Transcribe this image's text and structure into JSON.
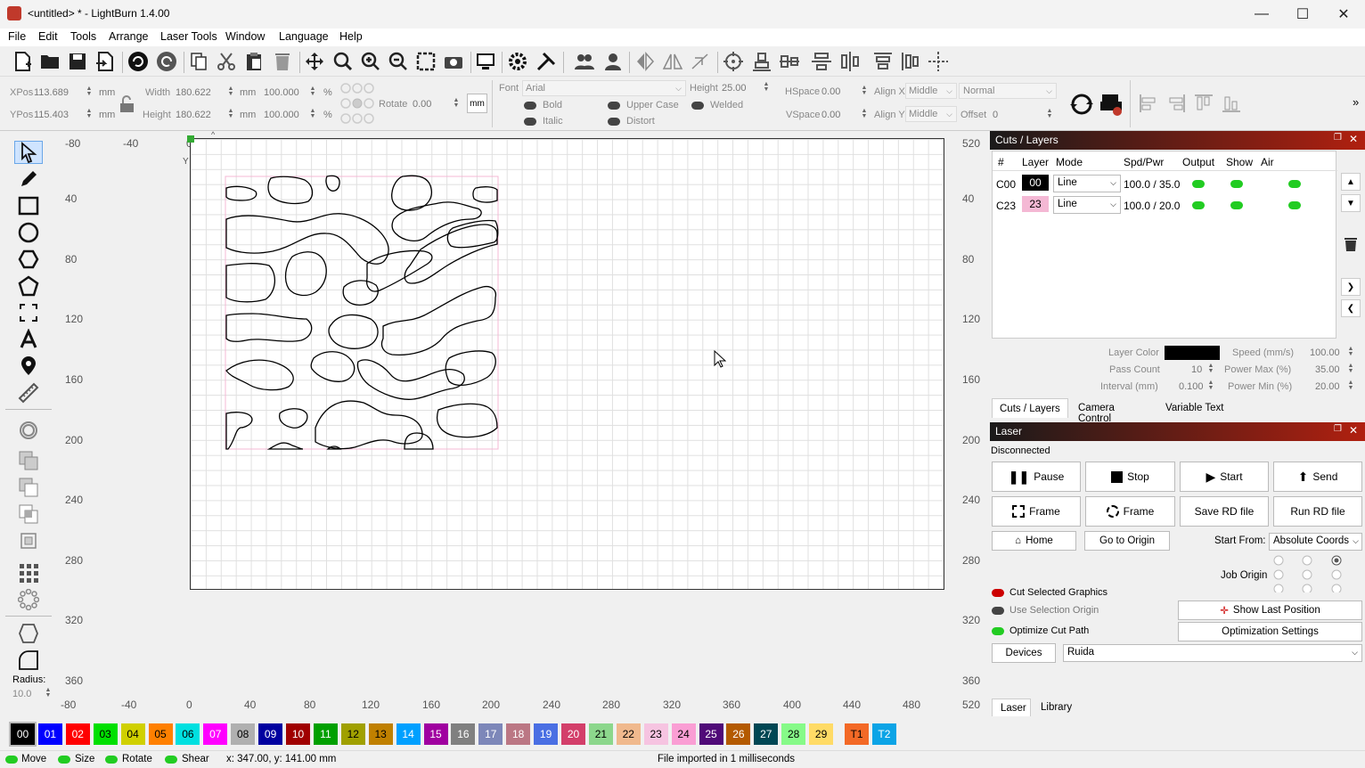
{
  "window": {
    "title": "<untitled> * - LightBurn 1.4.00"
  },
  "menu": [
    "File",
    "Edit",
    "Tools",
    "Arrange",
    "Laser Tools",
    "Window",
    "Language",
    "Help"
  ],
  "props": {
    "xpos_label": "XPos",
    "xpos": "113.689",
    "ypos_label": "YPos",
    "ypos": "115.403",
    "unit": "mm",
    "width_label": "Width",
    "width": "180.622",
    "height_label": "Height",
    "height": "180.622",
    "pct_w": "100.000",
    "pct_h": "100.000",
    "pct": "%",
    "rotate_label": "Rotate",
    "rotate": "0.00",
    "mm_btn": "mm",
    "font_label": "Font",
    "font": "Arial",
    "fheight_label": "Height",
    "fheight": "25.00",
    "bold": "Bold",
    "italic": "Italic",
    "upper": "Upper Case",
    "distort": "Distort",
    "welded": "Welded",
    "hspace_label": "HSpace",
    "hspace": "0.00",
    "vspace_label": "VSpace",
    "vspace": "0.00",
    "alignx_label": "Align X",
    "alignx": "Middle",
    "aligny_label": "Align Y",
    "aligny": "Middle",
    "normal": "Normal",
    "offset_label": "Offset",
    "offset": "0"
  },
  "ruler": {
    "top": [
      "-80",
      "-40",
      "0",
      "40",
      "80",
      "120",
      "160",
      "200",
      "240",
      "280",
      "320",
      "360",
      "400",
      "440",
      "480",
      "520"
    ],
    "left": [
      "40",
      "80",
      "120",
      "160",
      "200",
      "240",
      "280",
      "320",
      "360"
    ],
    "bottom": [
      "-80",
      "-40",
      "0",
      "40",
      "80",
      "120",
      "160",
      "200",
      "240",
      "280",
      "320",
      "360",
      "400",
      "440",
      "480",
      "520"
    ],
    "y_label": "Y"
  },
  "radius": {
    "label": "Radius:",
    "value": "10.0"
  },
  "cuts": {
    "title": "Cuts / Layers",
    "headers": [
      "#",
      "Layer",
      "Mode",
      "Spd/Pwr",
      "Output",
      "Show",
      "Air"
    ],
    "rows": [
      {
        "id": "C00",
        "layer": "00",
        "mode": "Line",
        "spdpwr": "100.0 / 35.0",
        "color": "#000000",
        "textcolor": "#ffffff"
      },
      {
        "id": "C23",
        "layer": "23",
        "mode": "Line",
        "spdpwr": "100.0 / 20.0",
        "color": "#f4b8d4",
        "textcolor": "#000000"
      }
    ],
    "layer_color_label": "Layer Color",
    "pass_count_label": "Pass Count",
    "pass_count": "10",
    "interval_label": "Interval (mm)",
    "interval": "0.100",
    "speed_label": "Speed (mm/s)",
    "speed": "100.00",
    "pmax_label": "Power Max (%)",
    "pmax": "35.00",
    "pmin_label": "Power Min (%)",
    "pmin": "20.00",
    "tabs": [
      "Cuts / Layers",
      "Camera Control",
      "Variable Text"
    ]
  },
  "laser": {
    "title": "Laser",
    "status": "Disconnected",
    "pause": "Pause",
    "stop": "Stop",
    "start": "Start",
    "send": "Send",
    "frame1": "Frame",
    "frame2": "Frame",
    "save_rd": "Save RD file",
    "run_rd": "Run RD file",
    "home": "Home",
    "goto_origin": "Go to Origin",
    "start_from_label": "Start From:",
    "start_from": "Absolute Coords",
    "job_origin": "Job Origin",
    "cut_selected": "Cut Selected Graphics",
    "use_sel_origin": "Use Selection Origin",
    "optimize": "Optimize Cut Path",
    "show_last": "Show Last Position",
    "opt_settings": "Optimization Settings",
    "devices": "Devices",
    "device": "Ruida",
    "tabs": [
      "Laser",
      "Library"
    ]
  },
  "palette": [
    {
      "l": "00",
      "c": "#000000",
      "t": "#fff"
    },
    {
      "l": "01",
      "c": "#0000ff",
      "t": "#fff"
    },
    {
      "l": "02",
      "c": "#ff0000",
      "t": "#fff"
    },
    {
      "l": "03",
      "c": "#00e000",
      "t": "#000"
    },
    {
      "l": "04",
      "c": "#d0d000",
      "t": "#000"
    },
    {
      "l": "05",
      "c": "#ff8000",
      "t": "#000"
    },
    {
      "l": "06",
      "c": "#00e0e0",
      "t": "#000"
    },
    {
      "l": "07",
      "c": "#ff00ff",
      "t": "#fff"
    },
    {
      "l": "08",
      "c": "#b0b0b0",
      "t": "#000"
    },
    {
      "l": "09",
      "c": "#0000a0",
      "t": "#fff"
    },
    {
      "l": "10",
      "c": "#a00000",
      "t": "#fff"
    },
    {
      "l": "11",
      "c": "#00a000",
      "t": "#fff"
    },
    {
      "l": "12",
      "c": "#a0a000",
      "t": "#000"
    },
    {
      "l": "13",
      "c": "#c08000",
      "t": "#000"
    },
    {
      "l": "14",
      "c": "#00a0ff",
      "t": "#fff"
    },
    {
      "l": "15",
      "c": "#a000a0",
      "t": "#fff"
    },
    {
      "l": "16",
      "c": "#808080",
      "t": "#fff"
    },
    {
      "l": "17",
      "c": "#7d87b9",
      "t": "#fff"
    },
    {
      "l": "18",
      "c": "#bb7784",
      "t": "#fff"
    },
    {
      "l": "19",
      "c": "#4a6fe3",
      "t": "#fff"
    },
    {
      "l": "20",
      "c": "#d33f6a",
      "t": "#fff"
    },
    {
      "l": "21",
      "c": "#8cd78c",
      "t": "#000"
    },
    {
      "l": "22",
      "c": "#f0b98d",
      "t": "#000"
    },
    {
      "l": "23",
      "c": "#f6c4e1",
      "t": "#000"
    },
    {
      "l": "24",
      "c": "#fa9ed4",
      "t": "#000"
    },
    {
      "l": "25",
      "c": "#500a78",
      "t": "#fff"
    },
    {
      "l": "26",
      "c": "#b45a00",
      "t": "#fff"
    },
    {
      "l": "27",
      "c": "#004754",
      "t": "#fff"
    },
    {
      "l": "28",
      "c": "#86fa88",
      "t": "#000"
    },
    {
      "l": "29",
      "c": "#ffdb66",
      "t": "#000"
    },
    {
      "l": "T1",
      "c": "#f36926",
      "t": "#000"
    },
    {
      "l": "T2",
      "c": "#0ca4e6",
      "t": "#fff"
    }
  ],
  "status": {
    "move": "Move",
    "size": "Size",
    "rotate": "Rotate",
    "shear": "Shear",
    "coords": "x: 347.00, y: 141.00 mm",
    "message": "File imported in 1 milliseconds"
  }
}
